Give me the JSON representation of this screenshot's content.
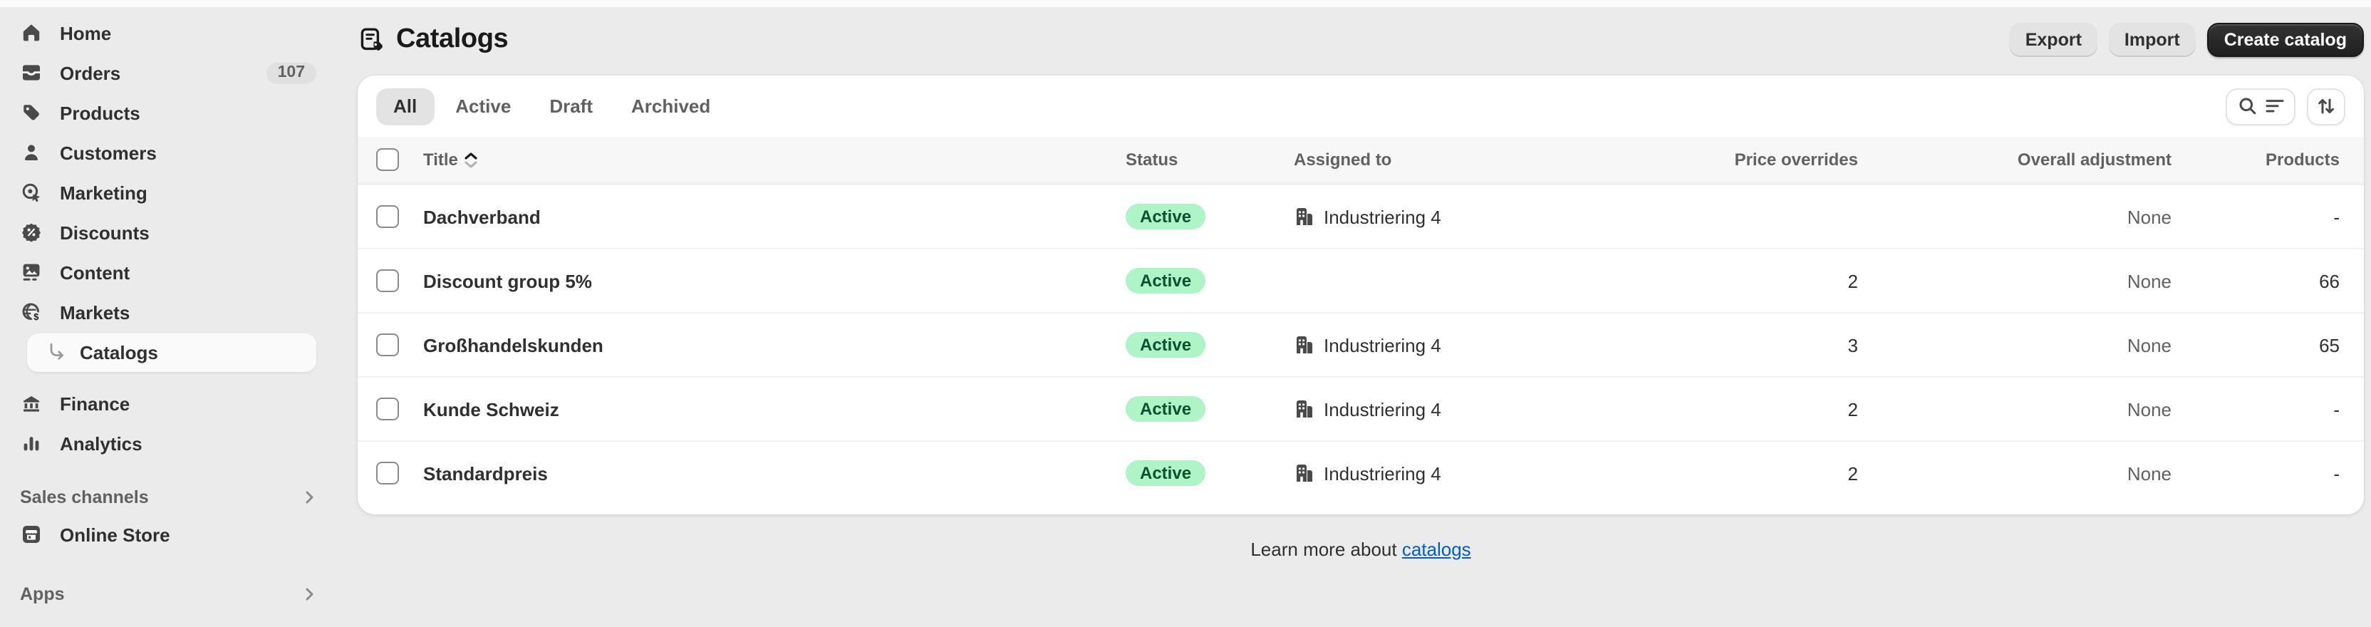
{
  "sidebar": {
    "items": [
      {
        "label": "Home",
        "icon": "home-icon"
      },
      {
        "label": "Orders",
        "icon": "orders-icon",
        "badge": "107"
      },
      {
        "label": "Products",
        "icon": "products-tag-icon"
      },
      {
        "label": "Customers",
        "icon": "customers-icon"
      },
      {
        "label": "Marketing",
        "icon": "marketing-icon"
      },
      {
        "label": "Discounts",
        "icon": "discounts-icon"
      },
      {
        "label": "Content",
        "icon": "content-icon"
      },
      {
        "label": "Markets",
        "icon": "markets-icon"
      }
    ],
    "sub_item": {
      "label": "Catalogs",
      "selected": true
    },
    "items_after": [
      {
        "label": "Finance",
        "icon": "finance-icon"
      },
      {
        "label": "Analytics",
        "icon": "analytics-icon"
      }
    ],
    "sections": [
      {
        "label": "Sales channels",
        "item": {
          "label": "Online Store",
          "icon": "online-store-icon"
        }
      },
      {
        "label": "Apps"
      }
    ]
  },
  "header": {
    "title": "Catalogs",
    "export_label": "Export",
    "import_label": "Import",
    "create_label": "Create catalog"
  },
  "tabs": [
    {
      "label": "All",
      "selected": true
    },
    {
      "label": "Active",
      "selected": false
    },
    {
      "label": "Draft",
      "selected": false
    },
    {
      "label": "Archived",
      "selected": false
    }
  ],
  "table": {
    "columns": {
      "title": "Title",
      "status": "Status",
      "assigned_to": "Assigned to",
      "price_overrides": "Price overrides",
      "overall_adjustment": "Overall adjustment",
      "products": "Products"
    },
    "rows": [
      {
        "title": "Dachverband",
        "status": "Active",
        "assigned_to": "Industriering 4",
        "price_overrides": "",
        "overall_adjustment": "None",
        "products": "-"
      },
      {
        "title": "Discount group 5%",
        "status": "Active",
        "assigned_to": "",
        "price_overrides": "2",
        "overall_adjustment": "None",
        "products": "66"
      },
      {
        "title": "Großhandelskunden",
        "status": "Active",
        "assigned_to": "Industriering 4",
        "price_overrides": "3",
        "overall_adjustment": "None",
        "products": "65"
      },
      {
        "title": "Kunde Schweiz",
        "status": "Active",
        "assigned_to": "Industriering 4",
        "price_overrides": "2",
        "overall_adjustment": "None",
        "products": "-"
      },
      {
        "title": "Standardpreis",
        "status": "Active",
        "assigned_to": "Industriering 4",
        "price_overrides": "2",
        "overall_adjustment": "None",
        "products": "-"
      }
    ]
  },
  "footer": {
    "text": "Learn more about ",
    "link_label": "catalogs"
  },
  "colors": {
    "page_bg": "#ebebeb",
    "card_bg": "#ffffff",
    "badge_green_bg": "#aff4c6",
    "badge_green_text": "#0a5132",
    "link_blue": "#005bd3",
    "primary_button_bg": "#1f1f1f",
    "secondary_button_bg": "#e3e3e3"
  }
}
